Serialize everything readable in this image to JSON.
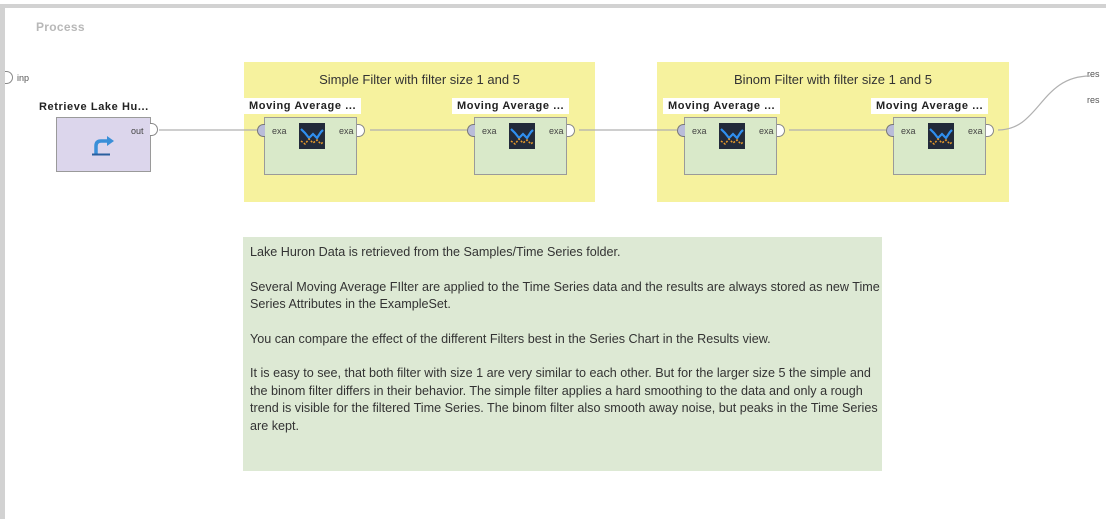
{
  "process": {
    "title": "Process",
    "input_port": "inp",
    "result_ports": [
      "res",
      "res"
    ]
  },
  "retrieve": {
    "name": "Retrieve Lake Hu...",
    "out_port": "out",
    "icon": "retrieve-arrow-icon"
  },
  "groups": [
    {
      "title": "Simple Filter with filter size 1 and 5",
      "operators": [
        {
          "name": "Moving Average ...",
          "in_port": "exa",
          "out_port": "exa",
          "icon": "moving-average-icon"
        },
        {
          "name": "Moving Average ...",
          "in_port": "exa",
          "out_port": "exa",
          "icon": "moving-average-icon"
        }
      ]
    },
    {
      "title": "Binom Filter with filter size 1 and 5",
      "operators": [
        {
          "name": "Moving Average ...",
          "in_port": "exa",
          "out_port": "exa",
          "icon": "moving-average-icon"
        },
        {
          "name": "Moving Average ...",
          "in_port": "exa",
          "out_port": "exa",
          "icon": "moving-average-icon"
        }
      ]
    }
  ],
  "note": {
    "paragraphs": [
      "Lake Huron Data is retrieved from the Samples/Time Series folder.",
      "Several Moving Average FIlter are applied to the Time Series data and the results are always stored as new Time Series Attributes in the ExampleSet.",
      "You can compare the effect of the different Filters best in the Series Chart in the Results view.",
      "It is easy to see, that both filter with size 1 are very similar to each other. But for the larger size 5 the simple and the binom filter differs in their behavior. The simple filter applies a hard smoothing to the data and only a rough trend is visible for the filtered Time Series. The binom filter also smooth away noise, but peaks in the Time Series are kept."
    ]
  },
  "colors": {
    "group_bg": "#f6f29e",
    "operator_bg": "#d9e9c9",
    "retrieve_bg": "#dcd6ec",
    "note_bg": "#dde9d4"
  }
}
